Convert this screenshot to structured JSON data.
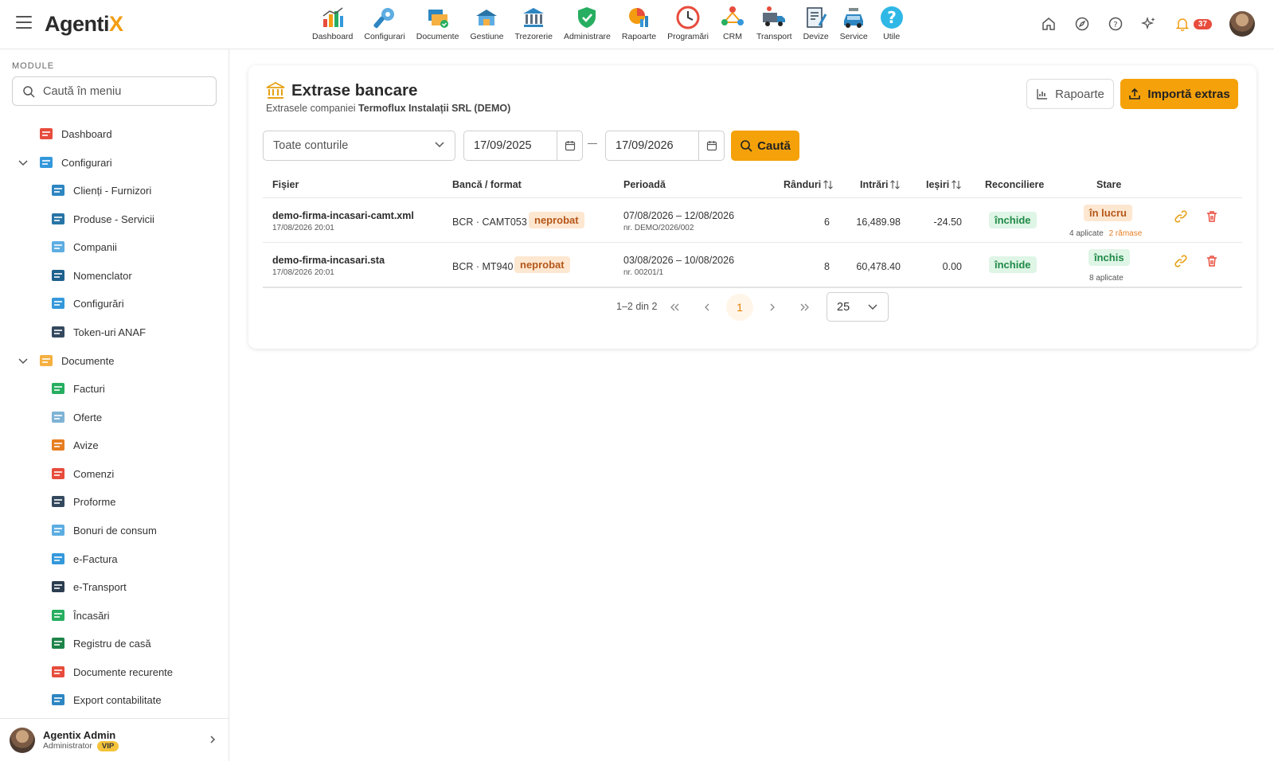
{
  "app": {
    "logo_main": "Agenti",
    "logo_x": "X"
  },
  "modules": [
    {
      "label": "Dashboard",
      "icon": "dashboard-icon"
    },
    {
      "label": "Configurari",
      "icon": "wrench-icon"
    },
    {
      "label": "Documente",
      "icon": "documents-icon"
    },
    {
      "label": "Gestiune",
      "icon": "warehouse-icon"
    },
    {
      "label": "Trezorerie",
      "icon": "bank-icon"
    },
    {
      "label": "Administrare",
      "icon": "shield-icon"
    },
    {
      "label": "Rapoarte",
      "icon": "report-icon"
    },
    {
      "label": "Programări",
      "icon": "clock-icon"
    },
    {
      "label": "CRM",
      "icon": "crm-icon"
    },
    {
      "label": "Transport",
      "icon": "truck-icon"
    },
    {
      "label": "Devize",
      "icon": "estimate-icon"
    },
    {
      "label": "Service",
      "icon": "car-icon"
    },
    {
      "label": "Utile",
      "icon": "help-icon"
    }
  ],
  "topright": {
    "notif_count": "37"
  },
  "sidebar": {
    "header": "MODULE",
    "search_placeholder": "Caută în meniu",
    "items": [
      {
        "label": "Dashboard"
      },
      {
        "label": "Configurari"
      },
      {
        "label": "Clienți - Furnizori"
      },
      {
        "label": "Produse - Servicii"
      },
      {
        "label": "Companii"
      },
      {
        "label": "Nomenclator"
      },
      {
        "label": "Configurări"
      },
      {
        "label": "Token-uri ANAF"
      },
      {
        "label": "Documente"
      },
      {
        "label": "Facturi"
      },
      {
        "label": "Oferte"
      },
      {
        "label": "Avize"
      },
      {
        "label": "Comenzi"
      },
      {
        "label": "Proforme"
      },
      {
        "label": "Bonuri de consum"
      },
      {
        "label": "e-Factura"
      },
      {
        "label": "e-Transport"
      },
      {
        "label": "Încasări"
      },
      {
        "label": "Registru de casă"
      },
      {
        "label": "Documente recurente"
      },
      {
        "label": "Export contabilitate"
      }
    ],
    "user": {
      "name": "Agentix Admin",
      "role": "Administrator",
      "badge": "VIP"
    }
  },
  "page": {
    "title": "Extrase bancare",
    "subtitle_prefix": "Extrasele companiei ",
    "company": "Termoflux Instalații SRL (DEMO)",
    "btn_reports": "Rapoarte",
    "btn_import": "Importă extras",
    "filter_account": "Toate conturile",
    "date_from": "17/09/2025",
    "date_to": "17/09/2026",
    "btn_search": "Caută"
  },
  "table": {
    "headers": {
      "file": "Fișier",
      "bank": "Bancă / format",
      "period": "Perioadă",
      "rows": "Rânduri",
      "in": "Intrări",
      "out": "Ieșiri",
      "recon": "Reconciliere",
      "state": "Stare"
    },
    "rows": [
      {
        "file": "demo-firma-incasari-camt.xml",
        "date": "17/08/2026 20:01",
        "bank": "BCR · CAMT053",
        "badge": "neprobat",
        "period": "07/08/2026 – 12/08/2026",
        "ref": "nr. DEMO/2026/002",
        "rows": "6",
        "in": "16,489.98",
        "out": "-24.50",
        "recon": "închide",
        "state": "în lucru",
        "applied": "4 aplicate",
        "remaining": "2 rămase"
      },
      {
        "file": "demo-firma-incasari.sta",
        "date": "17/08/2026 20:01",
        "bank": "BCR · MT940",
        "badge": "neprobat",
        "period": "03/08/2026 – 10/08/2026",
        "ref": "nr. 00201/1",
        "rows": "8",
        "in": "60,478.40",
        "out": "0.00",
        "recon": "închide",
        "state": "închis",
        "applied": "8 aplicate",
        "remaining": ""
      }
    ]
  },
  "pagination": {
    "info": "1–2 din 2",
    "current": "1",
    "page_size": "25"
  }
}
